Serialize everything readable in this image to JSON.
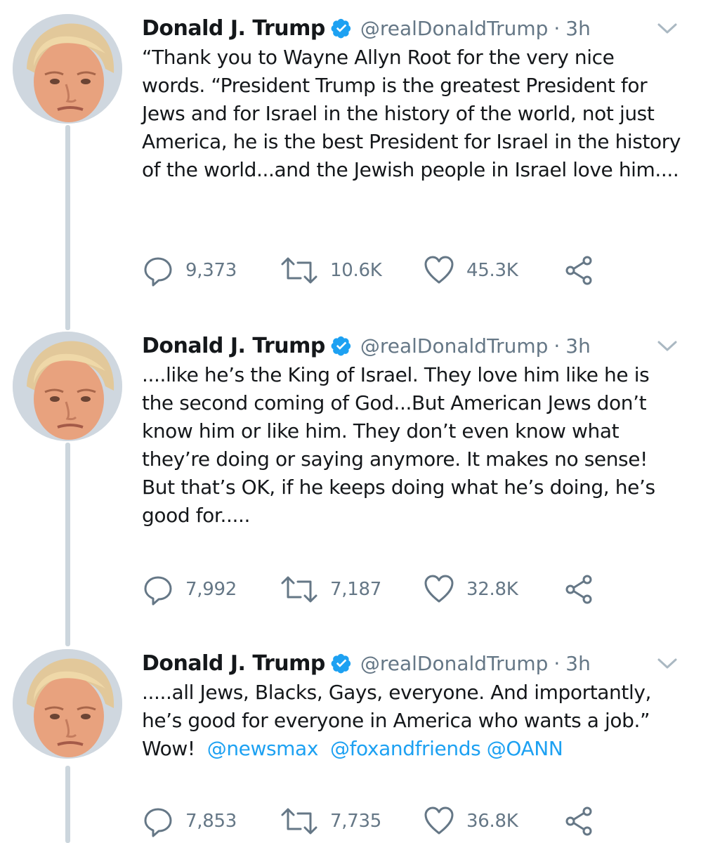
{
  "tweets": [
    {
      "name": "Donald J. Trump",
      "handle": "@realDonaldTrump",
      "separator": "·",
      "time": "3h",
      "text": "“Thank you to Wayne Allyn Root for the very nice words. “President Trump is the greatest President for Jews and for Israel in the history of the world, not just America, he is the best President for Israel in the history of the world...and the Jewish people in Israel love him....",
      "replies": "9,373",
      "retweets": "10.6K",
      "likes": "45.3K"
    },
    {
      "name": "Donald J. Trump",
      "handle": "@realDonaldTrump",
      "separator": "·",
      "time": "3h",
      "text": "....like he’s the King of Israel. They love him like he is the second coming of God...But American Jews don’t know him or like him. They don’t even know what they’re doing or saying anymore. It makes no sense! But that’s OK, if he keeps doing what he’s doing, he’s good for.....",
      "replies": "7,992",
      "retweets": "7,187",
      "likes": "32.8K"
    },
    {
      "name": "Donald J. Trump",
      "handle": "@realDonaldTrump",
      "separator": "·",
      "time": "3h",
      "text": ".....all Jews, Blacks, Gays, everyone. And importantly, he’s good for everyone in America who wants a job.” Wow!",
      "mentions": [
        "@newsmax",
        "@foxandfriends",
        "@OANN"
      ],
      "replies": "7,853",
      "retweets": "7,735",
      "likes": "36.8K"
    }
  ],
  "icons": {
    "verified": "verified-badge-icon",
    "caret": "chevron-down-icon",
    "reply": "reply-icon",
    "retweet": "retweet-icon",
    "like": "heart-icon",
    "share": "share-icon"
  },
  "colors": {
    "text": "#14171a",
    "secondary": "#657786",
    "link": "#1da1f2",
    "verified": "#1da1f2",
    "thread_line": "#ccd6dd"
  }
}
